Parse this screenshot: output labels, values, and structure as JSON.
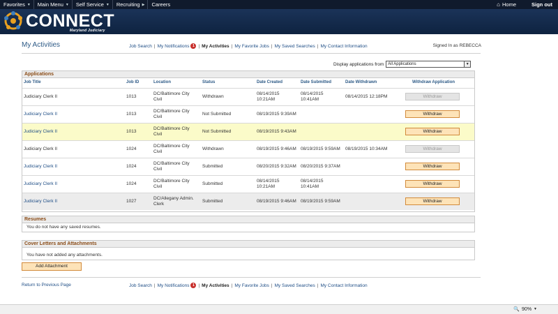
{
  "topnav": {
    "items": [
      {
        "label": "Favorites",
        "menu": true
      },
      {
        "label": "Main Menu",
        "menu": true
      },
      {
        "label": "Self Service",
        "menu": true
      },
      {
        "label": "Recruiting",
        "menu": true
      },
      {
        "label": "Careers",
        "menu": false
      }
    ],
    "home": "Home",
    "signout": "Sign out"
  },
  "brand": {
    "name": "CONNECT",
    "subtitle": "Maryland Judiciary",
    "accent": "#e9a020",
    "navy": "#0e2340"
  },
  "page": {
    "title": "My Activities",
    "signed_in": "Signed In as REBECCA"
  },
  "links": {
    "job_search": "Job Search",
    "notifications": "My Notifications",
    "notification_count": "1",
    "my_activities": "My Activities",
    "favorite_jobs": "My Favorite Jobs",
    "saved_searches": "My Saved Searches",
    "contact_info": "My Contact Information",
    "return": "Return to Previous Page"
  },
  "filter": {
    "label": "Display applications from",
    "value": "All Applications"
  },
  "applications": {
    "heading": "Applications",
    "columns": {
      "job_title": "Job Title",
      "job_id": "Job ID",
      "location": "Location",
      "status": "Status",
      "date_created": "Date Created",
      "date_submitted": "Date Submitted",
      "date_withdrawn": "Date Withdrawn",
      "withdraw": "Withdraw Application"
    },
    "rows": [
      {
        "title": "Judiciary Clerk II",
        "link": false,
        "id": "1013",
        "loc1": "DC/Baltimore City",
        "loc2": "Civil",
        "status": "Withdrawn",
        "c1": "08/14/2015",
        "c2": "10:21AM",
        "s1": "08/14/2015",
        "s2": "10:41AM",
        "w1": "08/14/2015 12:18PM",
        "btn": "Withdraw",
        "enabled": false,
        "style": ""
      },
      {
        "title": "Judiciary Clerk II",
        "link": true,
        "id": "1013",
        "loc1": "DC/Baltimore City",
        "loc2": "Civil",
        "status": "Not Submitted",
        "c1": "08/19/2015  9:39AM",
        "c2": "",
        "s1": "",
        "s2": "",
        "w1": "",
        "btn": "Withdraw",
        "enabled": true,
        "style": ""
      },
      {
        "title": "Judiciary Clerk II",
        "link": true,
        "id": "1013",
        "loc1": "DC/Baltimore City",
        "loc2": "Civil",
        "status": "Not Submitted",
        "c1": "08/19/2015  9:43AM",
        "c2": "",
        "s1": "",
        "s2": "",
        "w1": "",
        "btn": "Withdraw",
        "enabled": true,
        "style": "hl"
      },
      {
        "title": "Judiciary Clerk II",
        "link": false,
        "id": "1024",
        "loc1": "DC/Baltimore City",
        "loc2": "Civil",
        "status": "Withdrawn",
        "c1": "08/19/2015  9:46AM",
        "c2": "",
        "s1": "08/19/2015  9:59AM",
        "s2": "",
        "w1": "08/19/2015 10:34AM",
        "btn": "Withdraw",
        "enabled": false,
        "style": ""
      },
      {
        "title": "Judiciary Clerk II",
        "link": true,
        "id": "1024",
        "loc1": "DC/Baltimore City",
        "loc2": "Civil",
        "status": "Submitted",
        "c1": "08/20/2015  9:32AM",
        "c2": "",
        "s1": "08/20/2015  9:37AM",
        "s2": "",
        "w1": "",
        "btn": "Withdraw",
        "enabled": true,
        "style": ""
      },
      {
        "title": "Judiciary Clerk II",
        "link": true,
        "id": "1024",
        "loc1": "DC/Baltimore City",
        "loc2": "Civil",
        "status": "Submitted",
        "c1": "08/14/2015",
        "c2": "10:21AM",
        "s1": "08/14/2015",
        "s2": "10:41AM",
        "w1": "",
        "btn": "Withdraw",
        "enabled": true,
        "style": ""
      },
      {
        "title": "Judiciary Clerk II",
        "link": true,
        "id": "1027",
        "loc1": "DC/Allegany Admin.",
        "loc2": "Clerk",
        "status": "Submitted",
        "c1": "08/19/2015  9:46AM",
        "c2": "",
        "s1": "08/19/2015  9:59AM",
        "s2": "",
        "w1": "",
        "btn": "Withdraw",
        "enabled": true,
        "style": "gray"
      }
    ]
  },
  "resumes": {
    "heading": "Resumes",
    "message": "You do not have any saved resumes."
  },
  "cover": {
    "heading": "Cover Letters and Attachments",
    "message": "You have not added any attachments.",
    "add_button": "Add Attachment"
  },
  "statusbar": {
    "zoom": "90%"
  }
}
